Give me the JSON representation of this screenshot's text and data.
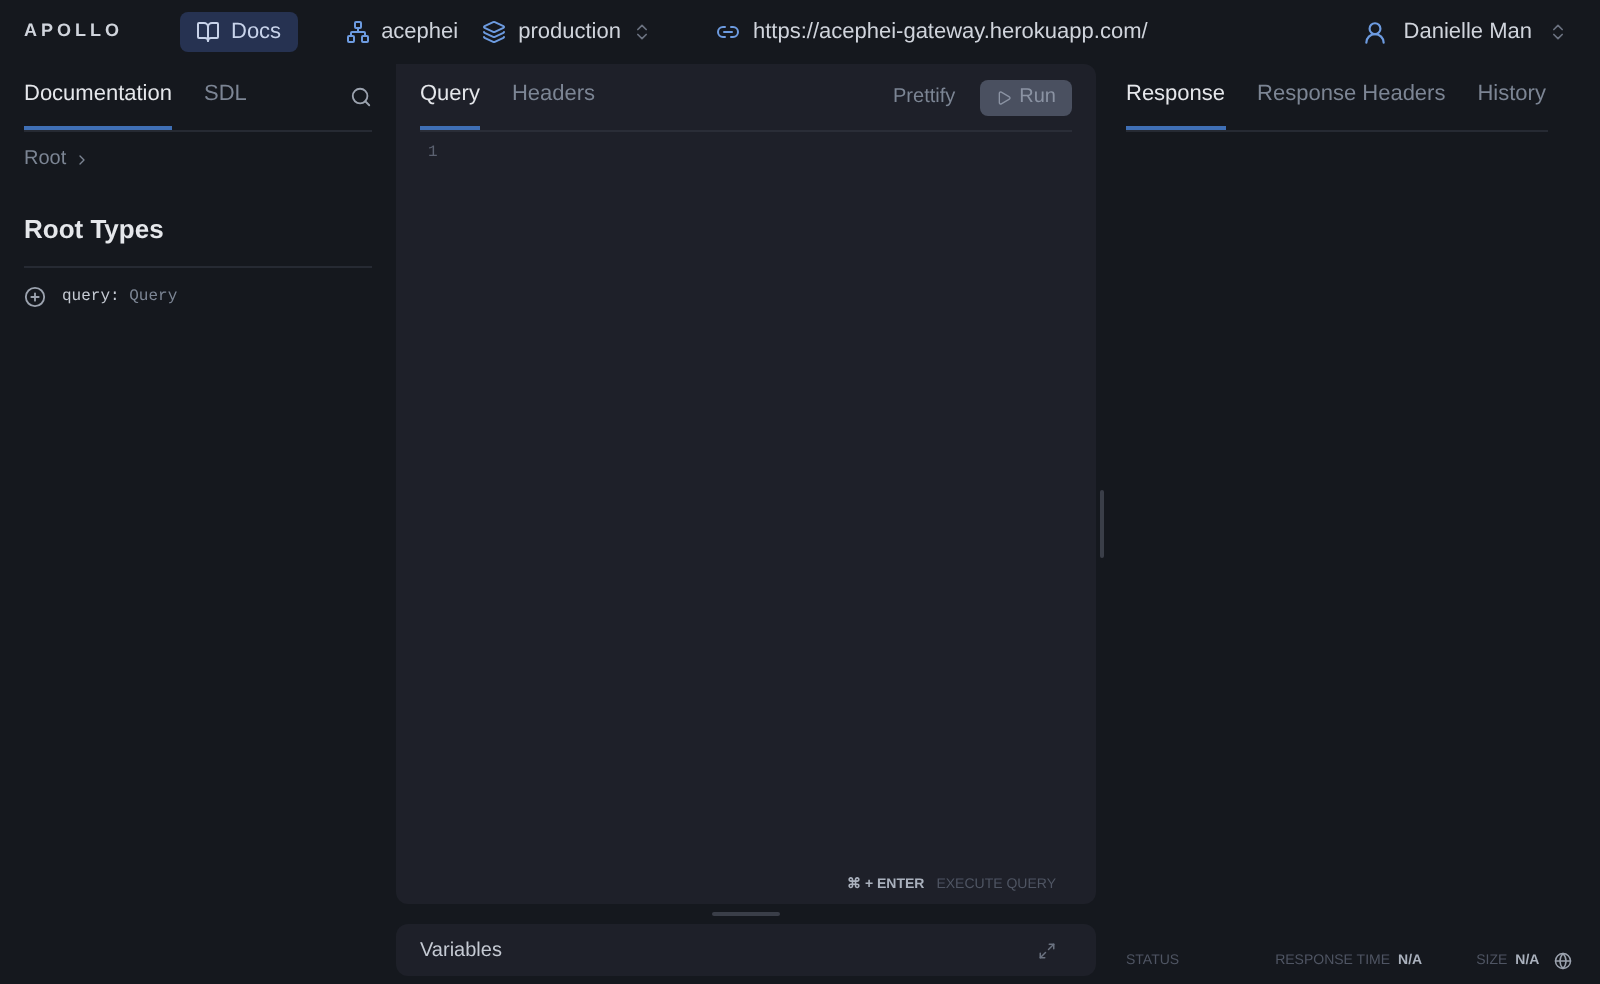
{
  "header": {
    "logo": "APOLLO",
    "docs_button": "Docs",
    "graph": "acephei",
    "variant": "production",
    "url": "https://acephei-gateway.herokuapp.com/",
    "user": "Danielle Man"
  },
  "docs_panel": {
    "tabs": [
      {
        "label": "Documentation",
        "selected": true
      },
      {
        "label": "SDL",
        "selected": false
      }
    ],
    "breadcrumb": "Root",
    "section_title": "Root Types",
    "fields": [
      {
        "name": "query:",
        "type": "Query"
      }
    ]
  },
  "editor": {
    "tabs": [
      {
        "label": "Query",
        "selected": true
      },
      {
        "label": "Headers",
        "selected": false
      }
    ],
    "prettify": "Prettify",
    "run": {
      "label": "Run",
      "disabled": true
    },
    "line_numbers": [
      "1"
    ],
    "shortcut": "⌘ + ENTER",
    "shortcut_label": "EXECUTE QUERY"
  },
  "variables": {
    "title": "Variables"
  },
  "response": {
    "tabs": [
      {
        "label": "Response",
        "selected": true
      },
      {
        "label": "Response Headers",
        "selected": false
      },
      {
        "label": "History",
        "selected": false
      }
    ],
    "status_label": "STATUS",
    "time_label": "RESPONSE TIME",
    "time_value": "N/A",
    "size_label": "SIZE",
    "size_value": "N/A"
  }
}
